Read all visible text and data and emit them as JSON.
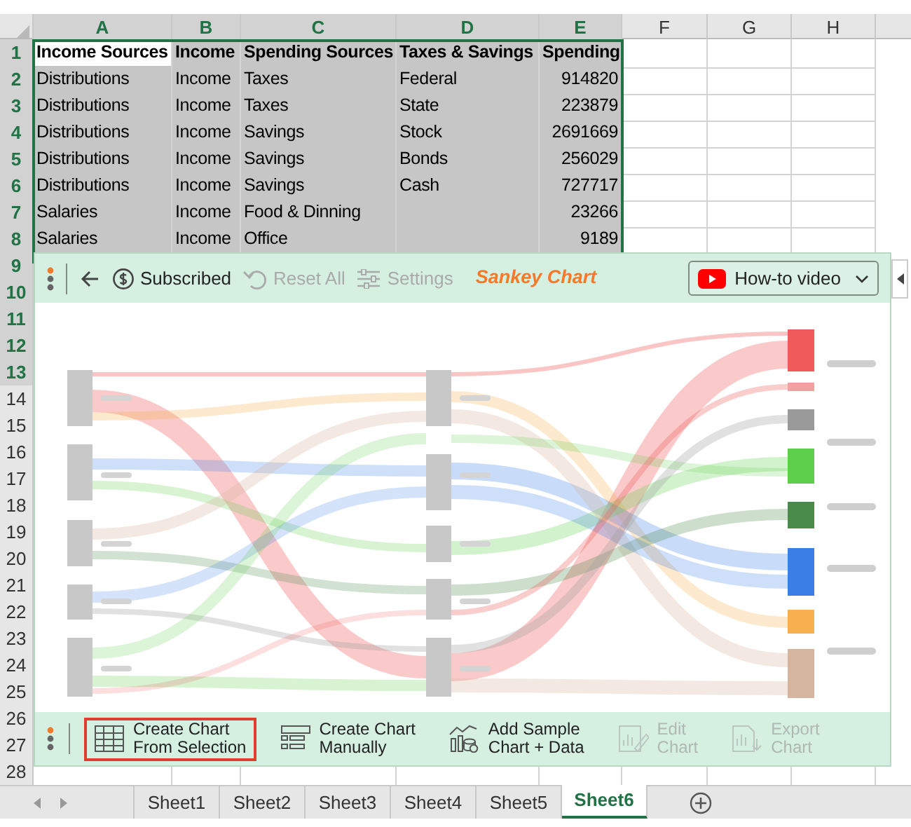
{
  "columns": [
    {
      "label": "A",
      "selected": true
    },
    {
      "label": "B",
      "selected": true
    },
    {
      "label": "C",
      "selected": true
    },
    {
      "label": "D",
      "selected": true
    },
    {
      "label": "E",
      "selected": true
    },
    {
      "label": "F",
      "selected": false
    },
    {
      "label": "G",
      "selected": false
    },
    {
      "label": "H",
      "selected": false
    }
  ],
  "rows": [
    {
      "number": "1",
      "selected": true,
      "kind": "header",
      "cells": [
        {
          "text": "Income Sources",
          "active": true
        },
        {
          "text": "Income",
          "active": false
        },
        {
          "text": "Spending Sources",
          "active": false
        },
        {
          "text": "Taxes & Savings",
          "active": false
        },
        {
          "text": "Spending",
          "active": false
        }
      ]
    },
    {
      "number": "2",
      "selected": true,
      "kind": "data",
      "cells": [
        {
          "text": "Distributions",
          "active": false
        },
        {
          "text": "Income",
          "active": false
        },
        {
          "text": "Taxes",
          "active": false
        },
        {
          "text": "Federal",
          "active": false
        },
        {
          "text": "914820",
          "active": false
        }
      ]
    },
    {
      "number": "3",
      "selected": true,
      "kind": "data",
      "cells": [
        {
          "text": "Distributions",
          "active": false
        },
        {
          "text": "Income",
          "active": false
        },
        {
          "text": "Taxes",
          "active": false
        },
        {
          "text": "State",
          "active": false
        },
        {
          "text": "223879",
          "active": false
        }
      ]
    },
    {
      "number": "4",
      "selected": true,
      "kind": "data",
      "cells": [
        {
          "text": "Distributions",
          "active": false
        },
        {
          "text": "Income",
          "active": false
        },
        {
          "text": "Savings",
          "active": false
        },
        {
          "text": "Stock",
          "active": false
        },
        {
          "text": "2691669",
          "active": false
        }
      ]
    },
    {
      "number": "5",
      "selected": true,
      "kind": "data",
      "cells": [
        {
          "text": "Distributions",
          "active": false
        },
        {
          "text": "Income",
          "active": false
        },
        {
          "text": "Savings",
          "active": false
        },
        {
          "text": "Bonds",
          "active": false
        },
        {
          "text": "256029",
          "active": false
        }
      ]
    },
    {
      "number": "6",
      "selected": true,
      "kind": "data",
      "cells": [
        {
          "text": "Distributions",
          "active": false
        },
        {
          "text": "Income",
          "active": false
        },
        {
          "text": "Savings",
          "active": false
        },
        {
          "text": "Cash",
          "active": false
        },
        {
          "text": "727717",
          "active": false
        }
      ]
    },
    {
      "number": "7",
      "selected": true,
      "kind": "data",
      "cells": [
        {
          "text": "Salaries",
          "active": false
        },
        {
          "text": "Income",
          "active": false
        },
        {
          "text": "Food & Dinning",
          "active": false
        },
        {
          "active": false
        },
        {
          "text": "23266",
          "active": false
        }
      ]
    },
    {
      "number": "8",
      "selected": true,
      "kind": "data",
      "cells": [
        {
          "text": "Salaries",
          "active": false
        },
        {
          "text": "Income",
          "active": false
        },
        {
          "text": "Office",
          "active": false
        },
        {
          "active": false
        },
        {
          "text": "9189",
          "active": false
        }
      ]
    },
    {
      "number": "9",
      "selected": true
    },
    {
      "number": "10",
      "selected": true
    },
    {
      "number": "11",
      "selected": true
    },
    {
      "number": "12",
      "selected": true
    },
    {
      "number": "13",
      "selected": true
    },
    {
      "number": "14",
      "selected": false
    },
    {
      "number": "15",
      "selected": false
    },
    {
      "number": "16",
      "selected": false
    },
    {
      "number": "17",
      "selected": false
    },
    {
      "number": "18",
      "selected": false
    },
    {
      "number": "19",
      "selected": false
    },
    {
      "number": "20",
      "selected": false
    },
    {
      "number": "21",
      "selected": false
    },
    {
      "number": "22",
      "selected": false
    },
    {
      "number": "23",
      "selected": false
    },
    {
      "number": "24",
      "selected": false
    },
    {
      "number": "25",
      "selected": false
    },
    {
      "number": "26",
      "selected": false
    },
    {
      "number": "27",
      "selected": false
    },
    {
      "number": "28",
      "selected": false
    }
  ],
  "add_in": {
    "title": "Sankey Chart",
    "top_toolbar": [
      {
        "kind": "coin",
        "label": "Subscribed",
        "disabled": false
      },
      {
        "kind": "undo",
        "label": "Reset All",
        "disabled": true
      },
      {
        "kind": "sliders",
        "label": "Settings",
        "disabled": true
      }
    ],
    "video_button": {
      "label": "How-to video"
    },
    "bottom_toolbar": [
      {
        "kind": "table",
        "lines": [
          "Create Chart",
          "From Selection"
        ],
        "selected": true,
        "disabled": false
      },
      {
        "kind": "form",
        "lines": [
          "Create Chart",
          "Manually"
        ],
        "selected": false,
        "disabled": false
      },
      {
        "kind": "sample",
        "lines": [
          "Add Sample",
          "Chart + Data"
        ],
        "selected": false,
        "disabled": false
      },
      {
        "kind": "edit",
        "lines": [
          "Edit",
          "Chart"
        ],
        "selected": false,
        "disabled": true
      },
      {
        "kind": "export",
        "lines": [
          "Export",
          "Chart"
        ],
        "selected": false,
        "disabled": true
      }
    ]
  },
  "sheet_tabs": [
    {
      "label": "Sheet1",
      "selected": false
    },
    {
      "label": "Sheet2",
      "selected": false
    },
    {
      "label": "Sheet3",
      "selected": false
    },
    {
      "label": "Sheet4",
      "selected": false
    },
    {
      "label": "Sheet5",
      "selected": false
    },
    {
      "label": "Sheet6",
      "selected": true
    }
  ]
}
